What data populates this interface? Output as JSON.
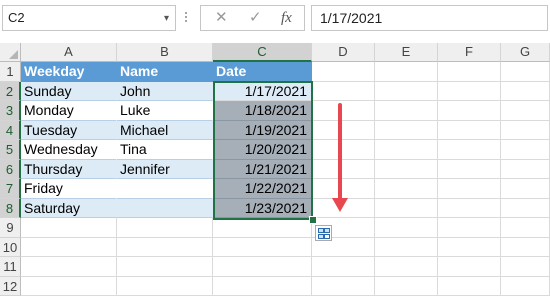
{
  "formula_bar": {
    "name_box": "C2",
    "name_box_caret": "▾",
    "cancel_glyph": "✕",
    "enter_glyph": "✓",
    "function_glyph": "fx",
    "formula": "1/17/2021"
  },
  "columns": [
    "A",
    "B",
    "C",
    "D",
    "E",
    "F",
    "G"
  ],
  "rows": [
    "1",
    "2",
    "3",
    "4",
    "5",
    "6",
    "7",
    "8",
    "9",
    "10",
    "11",
    "12"
  ],
  "table": {
    "headers": [
      "Weekday",
      "Name",
      "Date"
    ],
    "rows": [
      {
        "weekday": "Sunday",
        "name": "John",
        "date": "1/17/2021"
      },
      {
        "weekday": "Monday",
        "name": "Luke",
        "date": "1/18/2021"
      },
      {
        "weekday": "Tuesday",
        "name": "Michael",
        "date": "1/19/2021"
      },
      {
        "weekday": "Wednesday",
        "name": "Tina",
        "date": "1/20/2021"
      },
      {
        "weekday": "Thursday",
        "name": "Jennifer",
        "date": "1/21/2021"
      },
      {
        "weekday": "Friday",
        "name": "",
        "date": "1/22/2021"
      },
      {
        "weekday": "Saturday",
        "name": "",
        "date": "1/23/2021"
      }
    ]
  },
  "selection": {
    "range": "C2:C8",
    "active_cell": "C2"
  },
  "colors": {
    "header_fill": "#5b9bd5",
    "band_fill": "#ddebf7",
    "selection_border": "#217346",
    "arrow": "#e8474f"
  },
  "icons": {
    "autofill_options": "autofill-options-icon",
    "arrow": "down-arrow-icon"
  }
}
